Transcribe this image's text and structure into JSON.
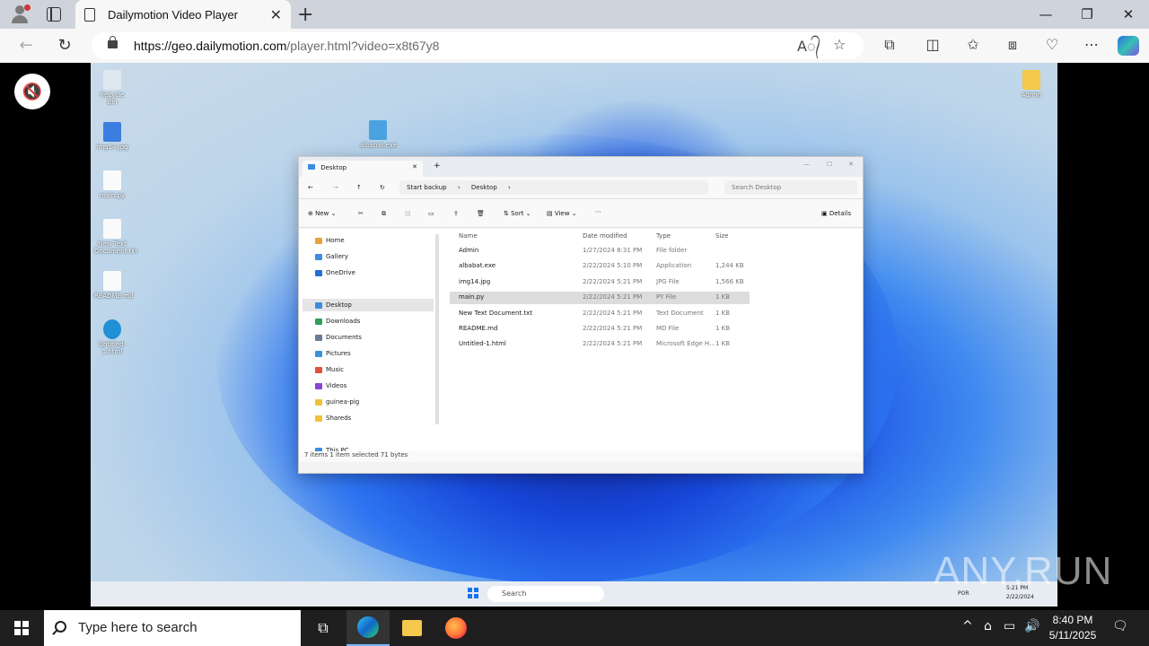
{
  "browser": {
    "tab_title": "Dailymotion Video Player",
    "url_host": "https://geo.dailymotion.com",
    "url_path": "/player.html?video=x8t67y8",
    "new_tab_symbol": "+",
    "close_tab_symbol": "✕",
    "minimize_symbol": "—",
    "restore_symbol": "❐",
    "close_symbol": "✕"
  },
  "video": {
    "mute_symbol": "🔇",
    "watermark": "ANY.RUN",
    "desktop_icons": [
      "Recycle Bin",
      "img14.jpg",
      "main.py",
      "New Text Document.txt",
      "README.md",
      "Untitled-1.html",
      "albabat.exe",
      "Admin"
    ],
    "explorer": {
      "tab_title": "Desktop",
      "breadcrumb_backup": "Start backup",
      "breadcrumb_location": "Desktop",
      "search_placeholder": "Search Desktop",
      "toolbar": {
        "new": "New",
        "sort": "Sort",
        "view": "View",
        "details": "Details"
      },
      "sidebar": [
        {
          "label": "Home",
          "color": "#e8a33d"
        },
        {
          "label": "Gallery",
          "color": "#3c8de0"
        },
        {
          "label": "OneDrive",
          "color": "#1e70d6"
        },
        {
          "label": "Desktop",
          "color": "#3c8de0"
        },
        {
          "label": "Downloads",
          "color": "#2e9f5c"
        },
        {
          "label": "Documents",
          "color": "#6a7b92"
        },
        {
          "label": "Pictures",
          "color": "#3a93d8"
        },
        {
          "label": "Music",
          "color": "#e0523c"
        },
        {
          "label": "Videos",
          "color": "#8a44d8"
        },
        {
          "label": "guinea-pig",
          "color": "#f0c23a"
        },
        {
          "label": "Shareds",
          "color": "#f0c23a"
        },
        {
          "label": "This PC",
          "color": "#3c8de0"
        }
      ],
      "columns": [
        "Name",
        "Date modified",
        "Type",
        "Size"
      ],
      "files": [
        {
          "name": "Admin",
          "date": "1/27/2024 8:31 PM",
          "type": "File folder",
          "size": ""
        },
        {
          "name": "albabat.exe",
          "date": "2/22/2024 5:10 PM",
          "type": "Application",
          "size": "1,244 KB"
        },
        {
          "name": "img14.jpg",
          "date": "2/22/2024 5:21 PM",
          "type": "JPG File",
          "size": "1,566 KB"
        },
        {
          "name": "main.py",
          "date": "2/22/2024 5:21 PM",
          "type": "PY File",
          "size": "1 KB"
        },
        {
          "name": "New Text Document.txt",
          "date": "2/22/2024 5:21 PM",
          "type": "Text Document",
          "size": "1 KB"
        },
        {
          "name": "README.md",
          "date": "2/22/2024 5:21 PM",
          "type": "MD File",
          "size": "1 KB"
        },
        {
          "name": "Untitled-1.html",
          "date": "2/22/2024 5:21 PM",
          "type": "Microsoft Edge H...",
          "size": "1 KB"
        }
      ],
      "status": "7 items    1 item selected  71 bytes"
    },
    "inner_taskbar": {
      "search": "Search",
      "lang": "POR",
      "time": "5:21 PM",
      "date": "2/22/2024"
    }
  },
  "taskbar": {
    "search_placeholder": "Type here to search",
    "time": "8:40 PM",
    "date": "5/11/2025"
  }
}
